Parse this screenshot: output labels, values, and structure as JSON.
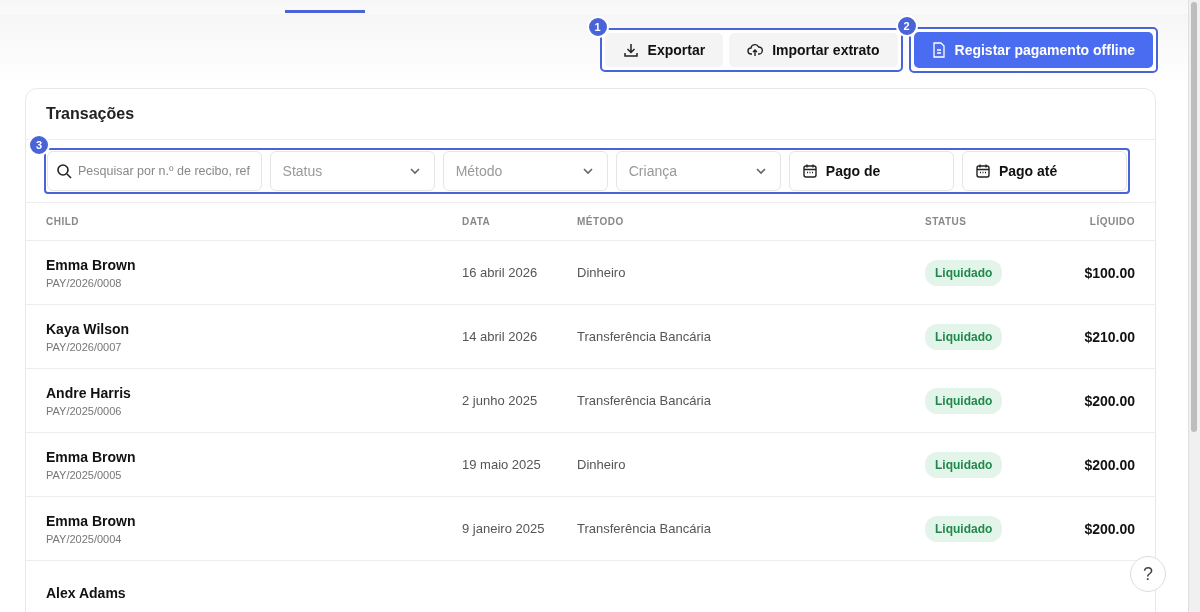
{
  "toolbar": {
    "group_marker": "1",
    "export_button": "Exportar",
    "import_button": "Importar extrato",
    "primary_marker": "2",
    "primary_button": "Registar pagamento offline"
  },
  "card": {
    "title": "Transações",
    "filters_marker": "3",
    "filters": [
      {
        "kind": "search",
        "placeholder": "Pesquisar por n.º de recibo, ref"
      },
      {
        "kind": "select",
        "placeholder": "Status"
      },
      {
        "kind": "select",
        "placeholder": "Método"
      },
      {
        "kind": "select",
        "placeholder": "Criança"
      },
      {
        "kind": "date",
        "label": "Pago de"
      },
      {
        "kind": "date",
        "label": "Pago até"
      }
    ],
    "columns": [
      "CHILD",
      "DATA",
      "MÉTODO",
      "STATUS",
      "LÍQUIDO"
    ],
    "rows": [
      {
        "child": "Emma Brown",
        "ref": "PAY/2026/0008",
        "date": "16 abril 2026",
        "method": "Dinheiro",
        "status": "Liquidado",
        "net": "$100.00"
      },
      {
        "child": "Kaya Wilson",
        "ref": "PAY/2026/0007",
        "date": "14 abril 2026",
        "method": "Transferência Bancária",
        "status": "Liquidado",
        "net": "$210.00"
      },
      {
        "child": "Andre Harris",
        "ref": "PAY/2025/0006",
        "date": "2 junho 2025",
        "method": "Transferência Bancária",
        "status": "Liquidado",
        "net": "$200.00"
      },
      {
        "child": "Emma Brown",
        "ref": "PAY/2025/0005",
        "date": "19 maio 2025",
        "method": "Dinheiro",
        "status": "Liquidado",
        "net": "$200.00"
      },
      {
        "child": "Emma Brown",
        "ref": "PAY/2025/0004",
        "date": "9 janeiro 2025",
        "method": "Transferência Bancária",
        "status": "Liquidado",
        "net": "$200.00"
      },
      {
        "child": "Alex Adams"
      }
    ]
  },
  "help_button": "?"
}
